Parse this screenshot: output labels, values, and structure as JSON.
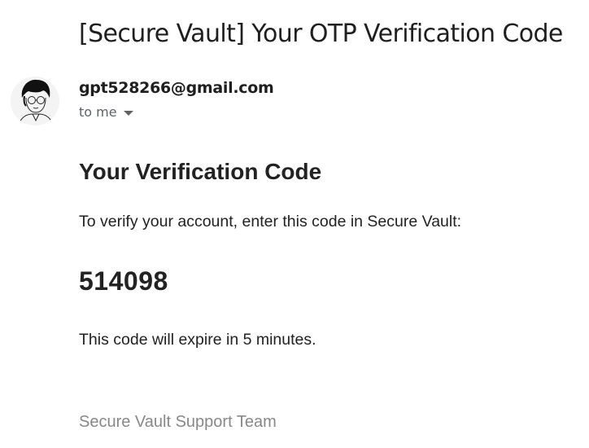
{
  "email": {
    "subject": "[Secure Vault] Your OTP Verification Code",
    "sender": "gpt528266@gmail.com",
    "recipient_label": "to me",
    "avatar": "sender-avatar-sketch"
  },
  "message": {
    "heading": "Your Verification Code",
    "intro": "To verify your account, enter this code in Secure Vault:",
    "code": "514098",
    "expiry": "This code will expire in 5 minutes.",
    "signature": "Secure Vault Support Team"
  },
  "icons": {
    "recipient_details": "caret-down-icon"
  }
}
